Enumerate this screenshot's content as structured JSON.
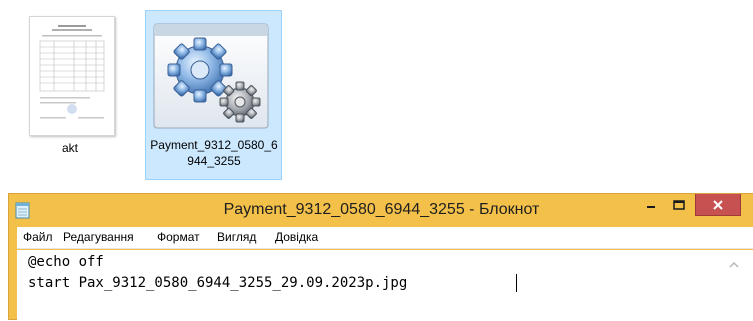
{
  "files": [
    {
      "name": "akt",
      "icon": "document-thumbnail-icon"
    },
    {
      "name": "Payment_9312_0580_6944_3255",
      "icon": "gears-application-icon",
      "selected": true
    }
  ],
  "notepad": {
    "title": "Payment_9312_0580_6944_3255 - Блокнот",
    "menu": [
      "Файл",
      "Редагування",
      "Формат",
      "Вигляд",
      "Довідка"
    ],
    "lines": [
      "@echo off",
      "start Pax_9312_0580_6944_3255_29.09.2023p.jpg"
    ],
    "colors": {
      "frame": "#f3c04a",
      "close_button": "#c75050",
      "selection": "#cce8ff"
    }
  }
}
